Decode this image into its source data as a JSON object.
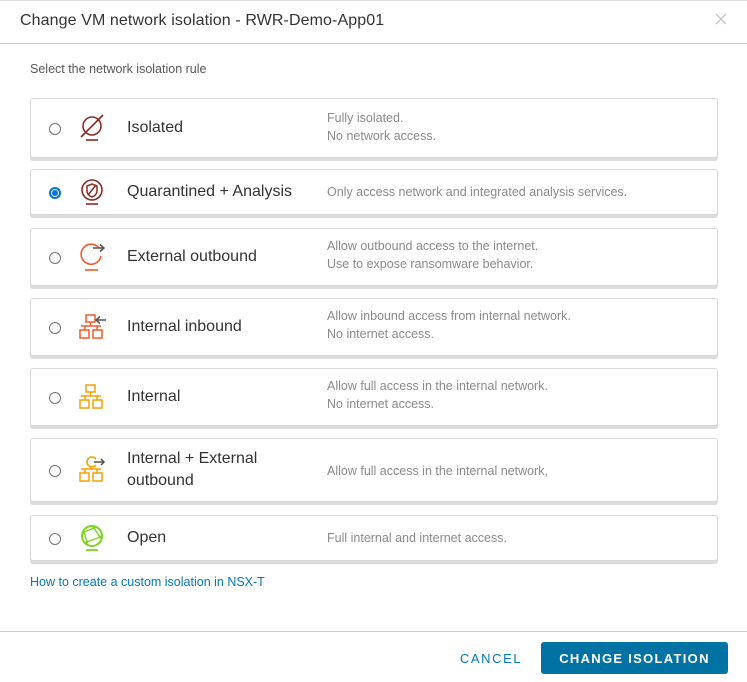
{
  "dialog": {
    "title": "Change VM network isolation - RWR-Demo-App01",
    "close_icon": "close-icon",
    "subtitle": "Select the network isolation rule"
  },
  "options": [
    {
      "label": "Isolated",
      "desc1": "Fully isolated.",
      "desc2": "No network access.",
      "icon": "isolated-icon",
      "color": "#8b2a24",
      "selected": false
    },
    {
      "label": "Quarantined + Analysis",
      "desc1": "Only access network and integrated analysis services.",
      "desc2": "",
      "icon": "quarantine-icon",
      "color": "#8b2a24",
      "selected": true
    },
    {
      "label": "External outbound",
      "desc1": "Allow outbound access to the internet.",
      "desc2": "Use to expose ransomware behavior.",
      "icon": "external-outbound-icon",
      "color": "#f05a28",
      "selected": false
    },
    {
      "label": "Internal inbound",
      "desc1": "Allow inbound access from internal network.",
      "desc2": "No internet access.",
      "icon": "internal-inbound-icon",
      "color": "#f05a28",
      "selected": false
    },
    {
      "label": "Internal",
      "desc1": "Allow full access in the internal network.",
      "desc2": "No internet access.",
      "icon": "internal-network-icon",
      "color": "#f5a000",
      "selected": false
    },
    {
      "label_line1": "Internal + External",
      "label_line2": "outbound",
      "desc1": "Allow full access in the internal network,",
      "desc2": "",
      "icon": "internal-external-icon",
      "color": "#f5a000",
      "selected": false
    },
    {
      "label": "Open",
      "desc1": "Full internal and internet access.",
      "desc2": "",
      "icon": "open-globe-icon",
      "color": "#7ed321",
      "selected": false
    }
  ],
  "link": "How to create a custom isolation in NSX-T",
  "footer": {
    "cancel_label": "CANCEL",
    "primary_label": "CHANGE ISOLATION"
  },
  "colors": {
    "accent": "#0072a3",
    "link": "#0079b8",
    "radio_selected": "#0072e6"
  }
}
